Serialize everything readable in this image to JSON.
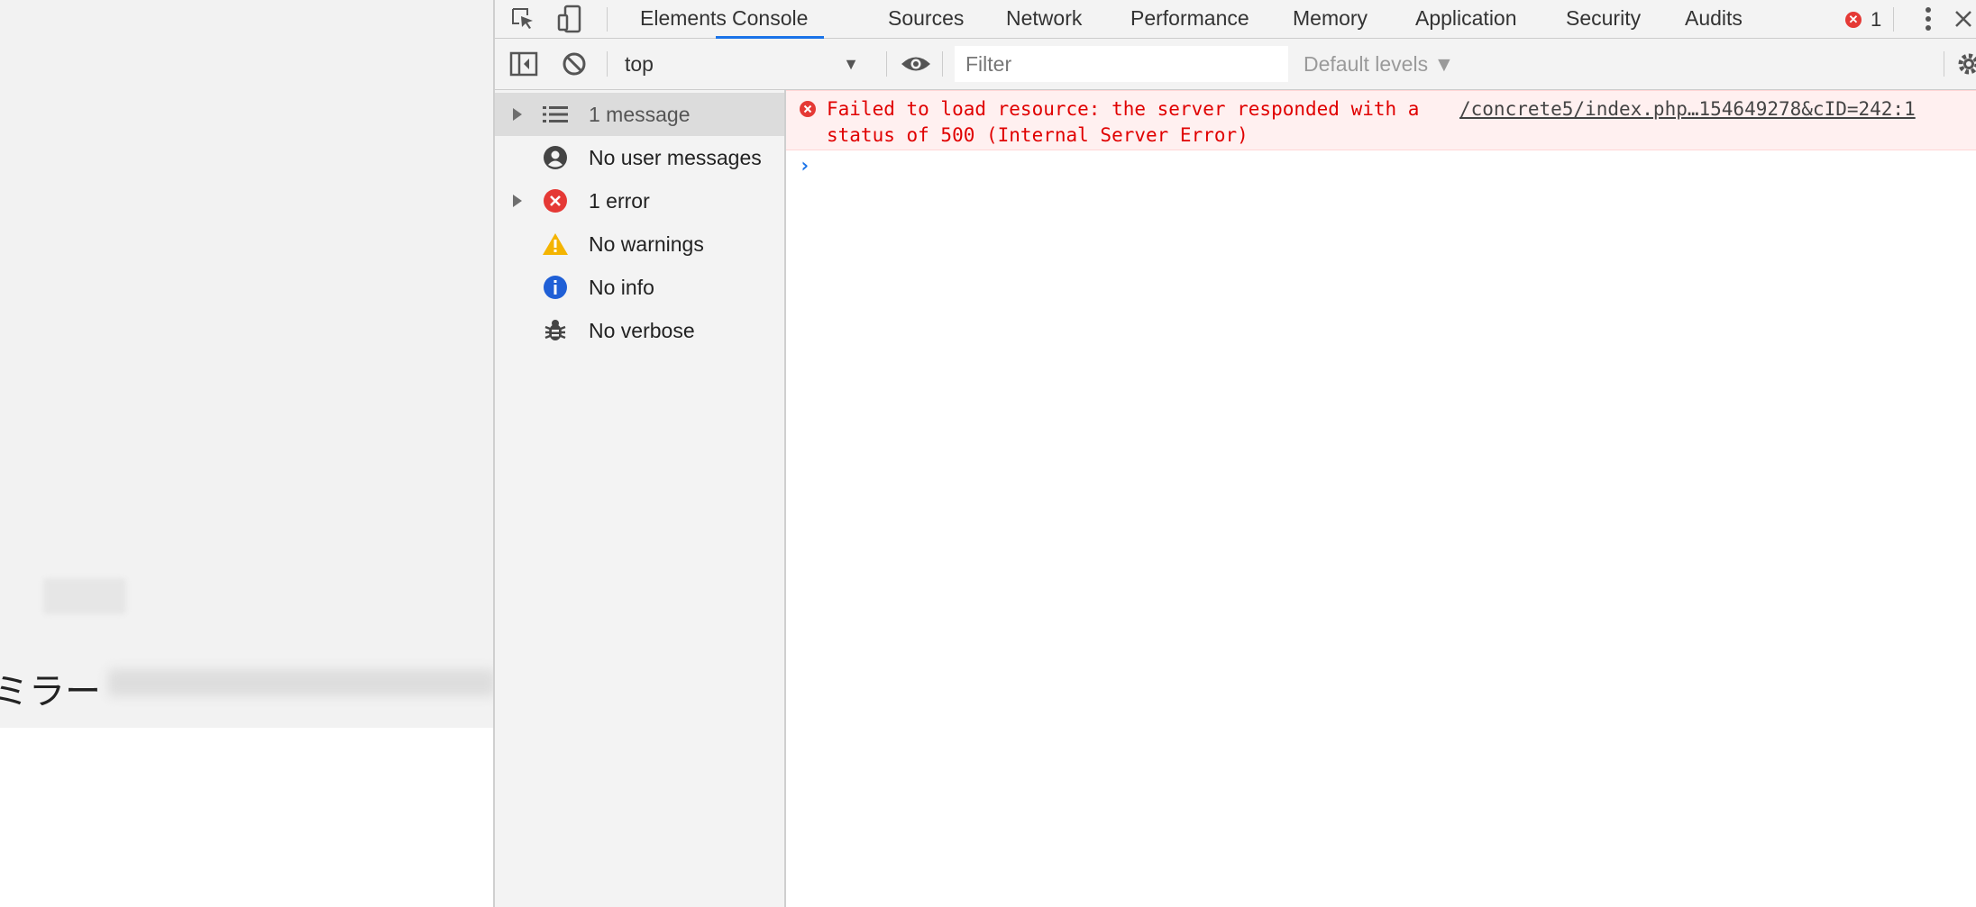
{
  "page": {
    "jp_text": "ミラー"
  },
  "devtools": {
    "tabs": [
      {
        "label": "Elements"
      },
      {
        "label": "Console",
        "active": true
      },
      {
        "label": "Sources"
      },
      {
        "label": "Network"
      },
      {
        "label": "Performance"
      },
      {
        "label": "Memory"
      },
      {
        "label": "Application"
      },
      {
        "label": "Security"
      },
      {
        "label": "Audits"
      }
    ],
    "error_count": "1",
    "toolbar": {
      "context": "top",
      "filter_placeholder": "Filter",
      "levels": "Default levels ▼"
    },
    "sidebar": {
      "items": [
        {
          "label": "1 message",
          "icon": "list-icon"
        },
        {
          "label": "No user messages",
          "icon": "user-icon"
        },
        {
          "label": "1 error",
          "icon": "error-icon"
        },
        {
          "label": "No warnings",
          "icon": "warning-icon"
        },
        {
          "label": "No info",
          "icon": "info-icon"
        },
        {
          "label": "No verbose",
          "icon": "bug-icon"
        }
      ]
    },
    "console": {
      "error_message": "Failed to load resource: the server responded with a status of 500 (Internal Server Error)",
      "error_source": "/concrete5/index.php…154649278&cID=242:1",
      "prompt": "›"
    },
    "colors": {
      "accent": "#1a73e8",
      "error": "#e53935",
      "warning": "#f4b400",
      "info": "#1f5fd6"
    }
  }
}
